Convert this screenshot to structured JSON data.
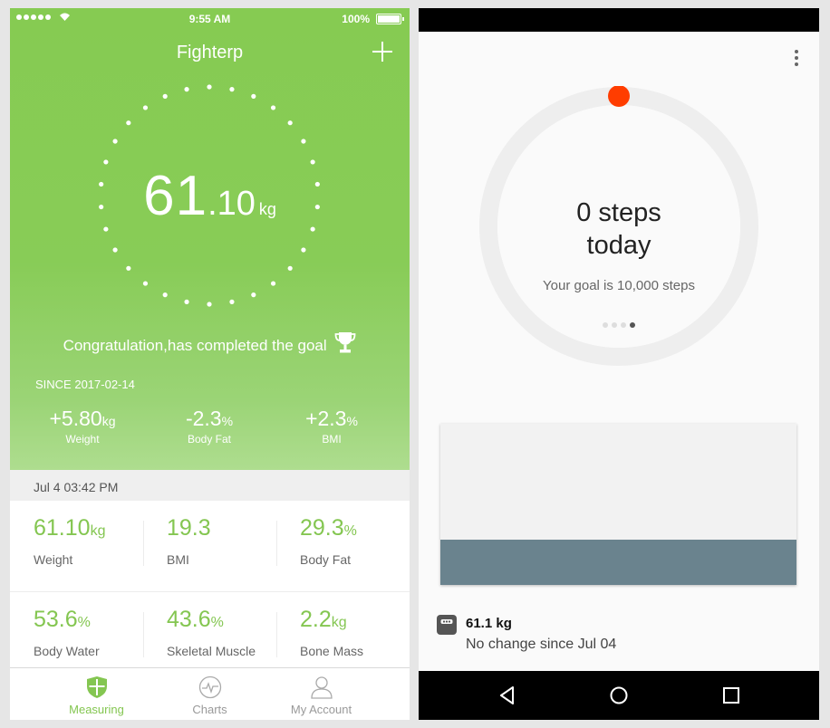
{
  "left_app": {
    "status_bar": {
      "time": "9:55 AM",
      "battery": "100%"
    },
    "title": "Fighterp",
    "weight": {
      "int": "61",
      "dec": ".10",
      "unit": "kg"
    },
    "congrats": "Congratulation,has completed the goal",
    "since": "SINCE 2017-02-14",
    "deltas": [
      {
        "value": "+5.80",
        "unit": "kg",
        "label": "Weight"
      },
      {
        "value": "-2.3",
        "unit": "%",
        "label": "Body Fat"
      },
      {
        "value": "+2.3",
        "unit": "%",
        "label": "BMI"
      }
    ],
    "measure_date": "Jul 4 03:42 PM",
    "metrics": [
      {
        "value": "61.10",
        "unit": "kg",
        "label": "Weight"
      },
      {
        "value": "19.3",
        "unit": "",
        "label": "BMI"
      },
      {
        "value": "29.3",
        "unit": "%",
        "label": "Body Fat"
      },
      {
        "value": "53.6",
        "unit": "%",
        "label": "Body Water"
      },
      {
        "value": "43.6",
        "unit": "%",
        "label": "Skeletal Muscle"
      },
      {
        "value": "2.2",
        "unit": "kg",
        "label": "Bone Mass"
      }
    ],
    "tabs": [
      {
        "label": "Measuring",
        "icon": "shield-icon",
        "active": true
      },
      {
        "label": "Charts",
        "icon": "pulse-icon",
        "active": false
      },
      {
        "label": "My Account",
        "icon": "person-icon",
        "active": false
      }
    ],
    "accent_color": "#84c651"
  },
  "right_app": {
    "steps_line1": "0 steps",
    "steps_line2": "today",
    "goal": "Your goal is 10,000 steps",
    "progress_fraction": 0,
    "page_dots": {
      "count": 4,
      "current": 4
    },
    "weight_summary": "61.1 kg",
    "weight_change": "No change since Jul 04",
    "indicator_color": "#ff3d00",
    "card_band_color": "#6a838e"
  }
}
